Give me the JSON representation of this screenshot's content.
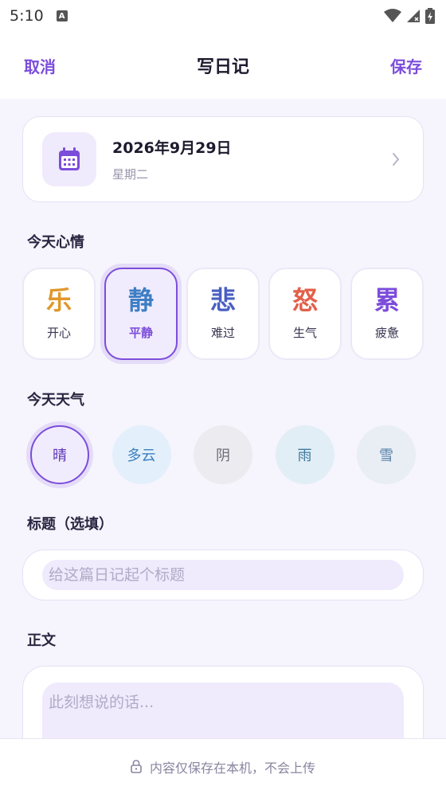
{
  "status_bar": {
    "time": "5:10",
    "notification_icon": "A"
  },
  "header": {
    "cancel_label": "取消",
    "title": "写日记",
    "save_label": "保存"
  },
  "date_card": {
    "date": "2026年9月29日",
    "weekday": "星期二"
  },
  "mood_section": {
    "title": "今天心情",
    "moods": [
      {
        "char": "乐",
        "label": "开心",
        "color": "#e0982a"
      },
      {
        "char": "静",
        "label": "平静",
        "color": "#3d7ec4"
      },
      {
        "char": "悲",
        "label": "难过",
        "color": "#4a5fc2"
      },
      {
        "char": "怒",
        "label": "生气",
        "color": "#e2604a"
      },
      {
        "char": "累",
        "label": "疲惫",
        "color": "#7c4ddb"
      }
    ],
    "selected": "平静"
  },
  "weather_section": {
    "title": "今天天气",
    "options": [
      {
        "label": "晴",
        "bg": "#f1ecfd",
        "color": "#5d36b8"
      },
      {
        "label": "多云",
        "bg": "#e3f0fb",
        "color": "#3c7fbf"
      },
      {
        "label": "阴",
        "bg": "#ececf0",
        "color": "#6b6b78"
      },
      {
        "label": "雨",
        "bg": "#e2eef5",
        "color": "#3c7a9e"
      },
      {
        "label": "雪",
        "bg": "#e8eef4",
        "color": "#5a82a8"
      }
    ],
    "selected": "晴"
  },
  "title_section": {
    "title": "标题（选填）",
    "placeholder": "给这篇日记起个标题"
  },
  "body_section": {
    "title": "正文",
    "placeholder": "此刻想说的话..."
  },
  "footer": {
    "note": "内容仅保存在本机，不会上传"
  },
  "colors": {
    "accent": "#7c4ddb",
    "background": "#f6f4fd"
  }
}
